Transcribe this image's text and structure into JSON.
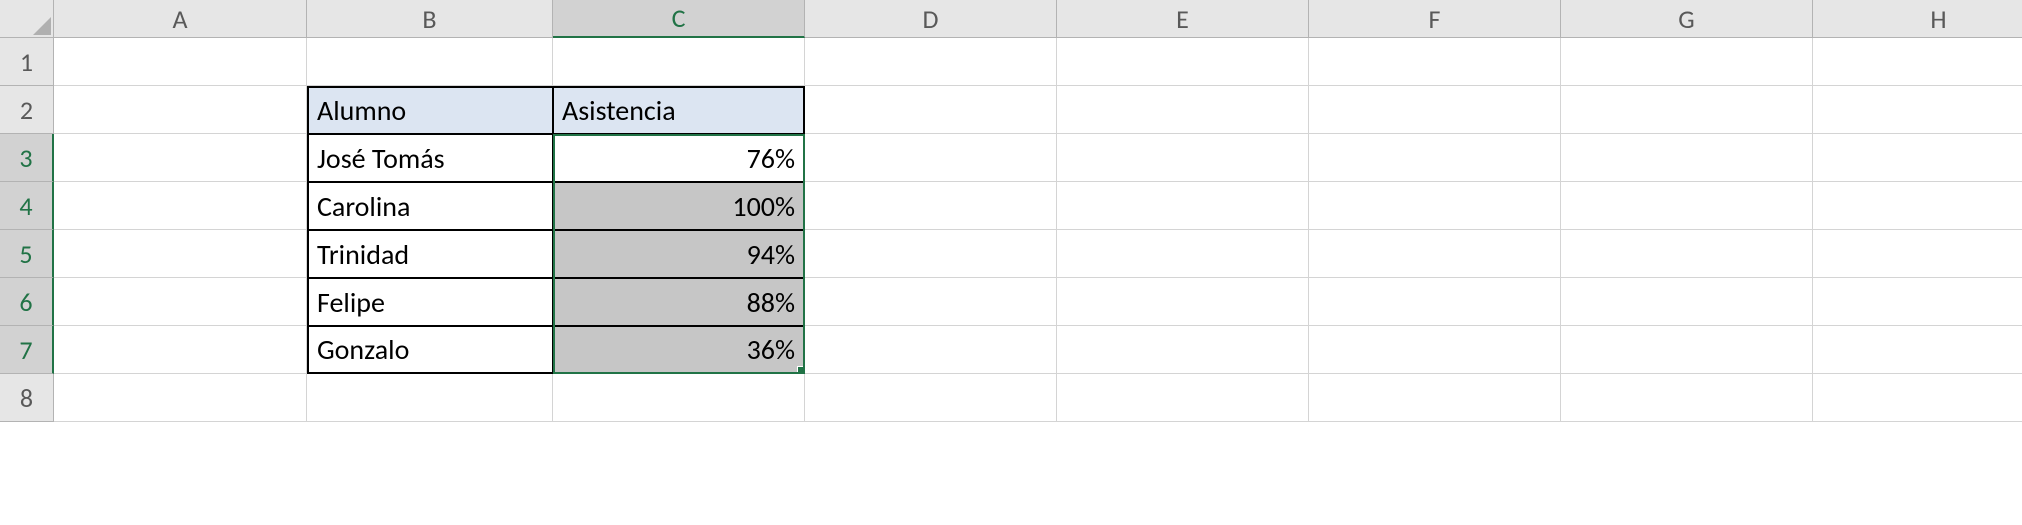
{
  "columns": [
    "A",
    "B",
    "C",
    "D",
    "E",
    "F",
    "G",
    "H"
  ],
  "rows": [
    "1",
    "2",
    "3",
    "4",
    "5",
    "6",
    "7",
    "8"
  ],
  "table": {
    "headers": {
      "alumno": "Alumno",
      "asistencia": "Asistencia"
    },
    "data": [
      {
        "alumno": "José Tomás",
        "asistencia": "76%"
      },
      {
        "alumno": "Carolina",
        "asistencia": "100%"
      },
      {
        "alumno": "Trinidad",
        "asistencia": "94%"
      },
      {
        "alumno": "Felipe",
        "asistencia": "88%"
      },
      {
        "alumno": "Gonzalo",
        "asistencia": "36%"
      }
    ]
  },
  "active_column": "C",
  "selected_rows": [
    "3",
    "4",
    "5",
    "6",
    "7"
  ]
}
